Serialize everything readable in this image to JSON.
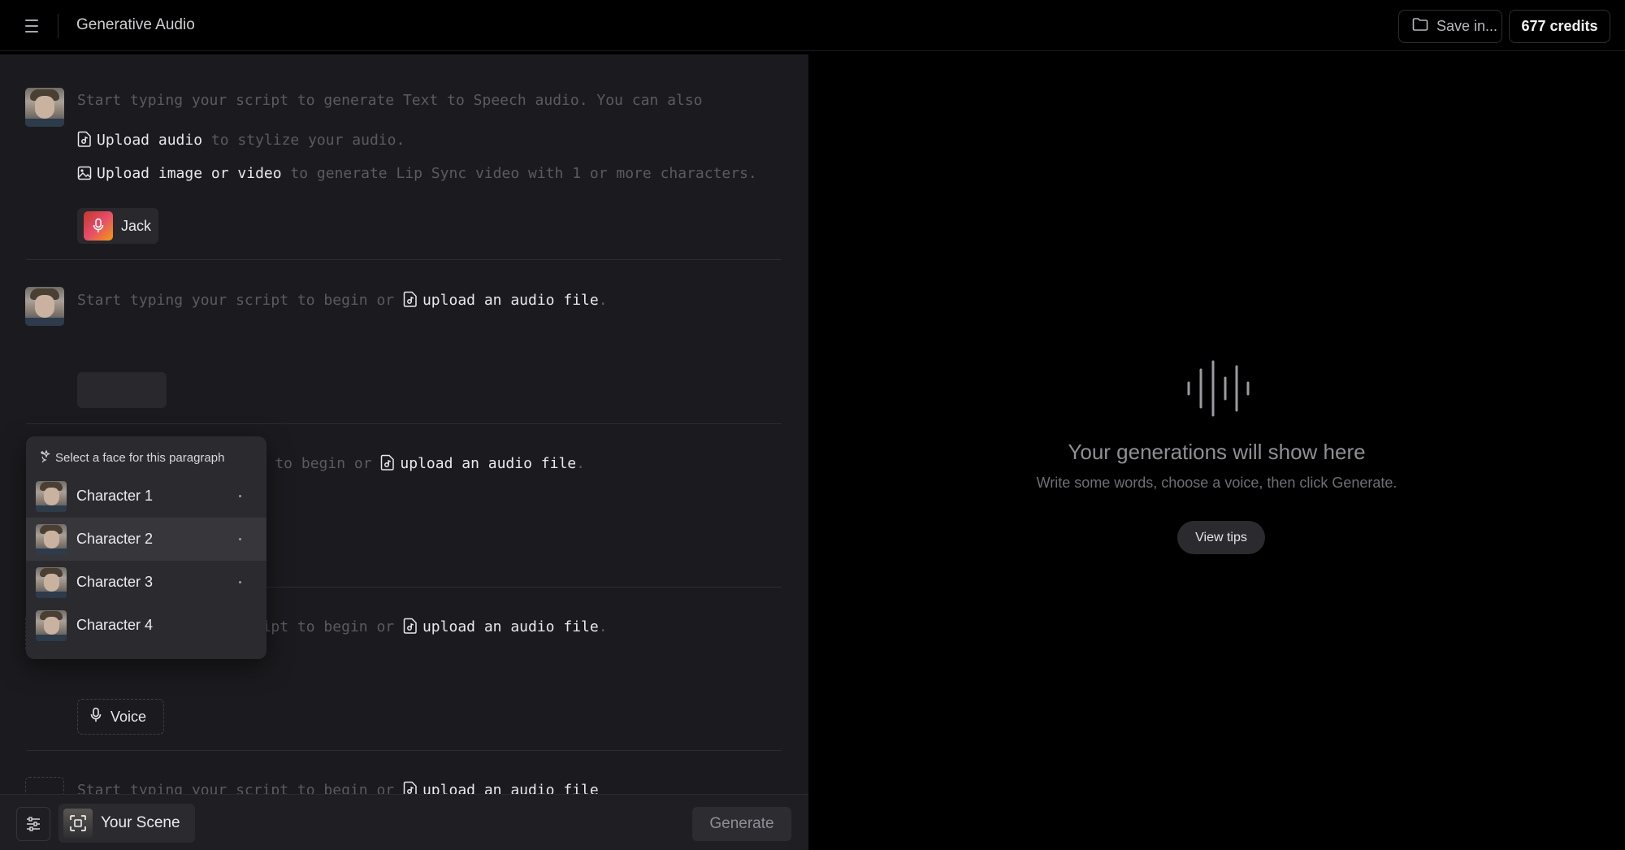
{
  "topbar": {
    "title": "Generative Audio",
    "save_label": "Save in...",
    "credits_label": "677 credits"
  },
  "paragraphs": [
    {
      "intro": "Start typing your script to generate Text to Speech audio. You can also",
      "upload_audio_label": "Upload audio",
      "upload_audio_suffix": " to stylize your audio.",
      "upload_media_label": "Upload image or video",
      "upload_media_suffix": " to generate Lip Sync video with 1 or more characters.",
      "voice_label": "Jack"
    },
    {
      "prefix": "Start typing your script to begin or ",
      "link": "upload an audio file",
      "suffix": "."
    },
    {
      "prefix": "ipt to begin or ",
      "link": "upload an audio file",
      "suffix": "."
    },
    {
      "prefix": "Start typing your script to begin or ",
      "link": "upload an audio file",
      "suffix": ".",
      "voice_label": "Voice"
    },
    {
      "prefix": "Start typing your script to begin or ",
      "link": "upload an audio file"
    }
  ],
  "face_menu": {
    "header": "Select a face for this paragraph",
    "items": [
      {
        "label": "Character 1"
      },
      {
        "label": "Character 2"
      },
      {
        "label": "Character 3"
      },
      {
        "label": "Character 4"
      }
    ]
  },
  "bottom_bar": {
    "scene_label": "Your Scene",
    "generate_label": "Generate"
  },
  "empty_state": {
    "title": "Your generations will show here",
    "subtitle": "Write some words, choose a voice, then click Generate.",
    "tips_label": "View tips"
  },
  "icons": [
    "menu-icon",
    "folder-icon",
    "file-audio-icon",
    "image-icon",
    "mic-icon",
    "face-add-icon",
    "sparkle-icon",
    "settings-sliders-icon",
    "scene-icon",
    "waveform-icon"
  ]
}
